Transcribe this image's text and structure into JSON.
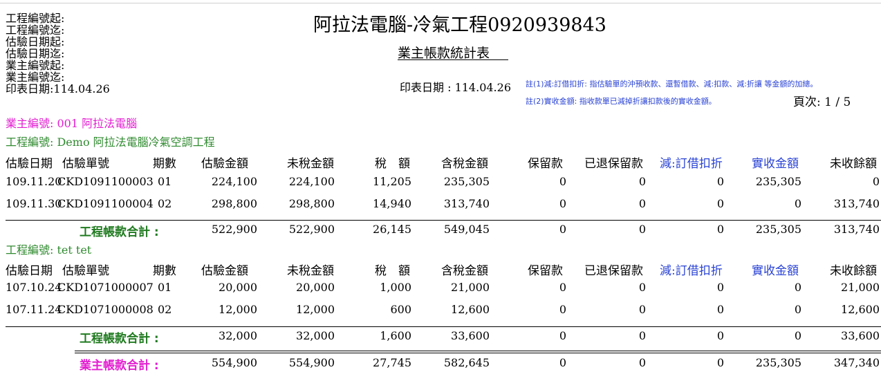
{
  "filters": [
    "工程編號起:",
    "工程編號迄:",
    "估驗日期起:",
    "估驗日期迄:",
    "業主編號起:",
    "業主編號迄:",
    "印表日期:114.04.26"
  ],
  "title": "阿拉法電腦-冷氣工程0920939843",
  "subtitle": "業主帳款統計表",
  "print_date": "印表日期 : 114.04.26",
  "notes": [
    "註(1)減:訂借扣折: 指估驗單的沖預收款、還暫借款、減:扣款、減:折讓 等金額的加總。",
    "註(2)實收金額: 指收款單已減掉折讓扣款後的實收金額。"
  ],
  "page": "頁次:   1  /  5",
  "owner": "業主編號: 001 阿拉法電腦",
  "columns": [
    "估驗日期",
    "估驗單號",
    "期數",
    "估驗金額",
    "未稅金額",
    "稅　額",
    "含稅金額",
    "保留款",
    "已退保留款",
    "減:訂借扣折",
    "實收金額",
    "未收餘額"
  ],
  "projects": [
    {
      "label": "工程編號: Demo 阿拉法電腦冷氣空調工程",
      "rows": [
        [
          "109.11.20",
          "CKD1091100003",
          "01",
          "224,100",
          "224,100",
          "11,205",
          "235,305",
          "0",
          "0",
          "0",
          "235,305",
          "0"
        ],
        [
          "109.11.30",
          "CKD1091100004",
          "02",
          "298,800",
          "298,800",
          "14,940",
          "313,740",
          "0",
          "0",
          "0",
          "0",
          "313,740"
        ]
      ],
      "subtotal_label": "工程帳款合計 :",
      "subtotal": [
        "522,900",
        "522,900",
        "26,145",
        "549,045",
        "0",
        "0",
        "0",
        "235,305",
        "313,740"
      ]
    },
    {
      "label": "工程編號: tet tet",
      "rows": [
        [
          "107.10.24",
          "CKD1071000007",
          "01",
          "20,000",
          "20,000",
          "1,000",
          "21,000",
          "0",
          "0",
          "0",
          "0",
          "21,000"
        ],
        [
          "107.11.24",
          "CKD1071000008",
          "02",
          "12,000",
          "12,000",
          "600",
          "12,600",
          "0",
          "0",
          "0",
          "0",
          "12,600"
        ]
      ],
      "subtotal_label": "工程帳款合計 :",
      "subtotal": [
        "32,000",
        "32,000",
        "1,600",
        "33,600",
        "0",
        "0",
        "0",
        "0",
        "33,600"
      ]
    }
  ],
  "owner_total_label": "業主帳款合計 :",
  "owner_total": [
    "554,900",
    "554,900",
    "27,745",
    "582,645",
    "0",
    "0",
    "0",
    "235,305",
    "347,340"
  ],
  "colors": {
    "owner": "#e21ed0",
    "project": "#2f8a2f",
    "subtotal": "#1f7a1f",
    "accent_blue": "#2a43d4"
  }
}
